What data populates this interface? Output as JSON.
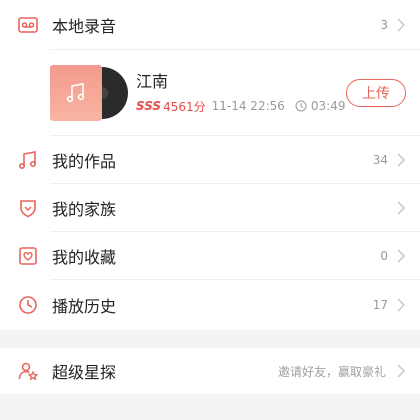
{
  "local_recordings": {
    "label": "本地录音",
    "count": "3",
    "icon": "cassette-icon"
  },
  "song": {
    "title": "江南",
    "grade": "SSS",
    "score": "4561分",
    "date": "11-14 22:56",
    "duration": "03:49",
    "upload_label": "上传"
  },
  "menu": [
    {
      "key": "works",
      "label": "我的作品",
      "count": "34",
      "icon": "music-note-icon"
    },
    {
      "key": "family",
      "label": "我的家族",
      "count": "",
      "icon": "shield-icon"
    },
    {
      "key": "favorites",
      "label": "我的收藏",
      "count": "0",
      "icon": "heart-box-icon"
    },
    {
      "key": "history",
      "label": "播放历史",
      "count": "17",
      "icon": "clock-icon"
    }
  ],
  "scout": {
    "label": "超级星探",
    "subtitle": "邀请好友，赢取豪礼",
    "icon": "user-star-icon"
  },
  "colors": {
    "accent": "#e8665c",
    "score_red": "#e94b4b"
  }
}
